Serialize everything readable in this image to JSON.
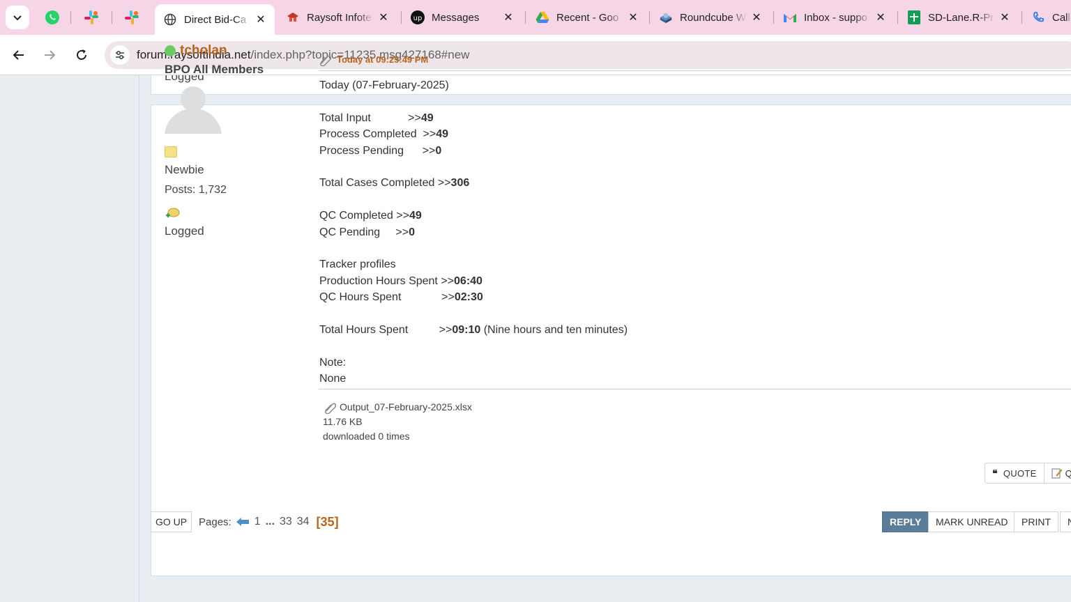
{
  "browser": {
    "tabs": [
      {
        "title": "Direct Bid-Ca",
        "active": true,
        "icon": "globe-icon"
      },
      {
        "title": "Raysoft Infote",
        "icon": "raysoft-icon"
      },
      {
        "title": "Messages",
        "icon": "upwork-icon"
      },
      {
        "title": "Recent - Goo",
        "icon": "google-drive-icon"
      },
      {
        "title": "Roundcube W",
        "icon": "roundcube-icon"
      },
      {
        "title": "Inbox - suppo",
        "icon": "gmail-icon"
      },
      {
        "title": "SD-Lane.R-Pr",
        "icon": "google-sheets-icon"
      },
      {
        "title": "Call",
        "icon": "phone-icon"
      }
    ],
    "url_host": "forum.raysoftindia.net",
    "url_path": "/index.php?topic=11235.msg427168#new"
  },
  "previous_post": {
    "logged": "Logged"
  },
  "poster": {
    "name": "tcholan",
    "group": "BPO All Members",
    "rank": "Newbie",
    "posts": "Posts: 1,732",
    "logged": "Logged"
  },
  "post": {
    "time": "Today at 09:25:49 PM",
    "lines": [
      {
        "label": "Today (07-February-2025)",
        "value": ""
      },
      {
        "gap": true
      },
      {
        "label": "Total Input            >>",
        "value": "49"
      },
      {
        "label": "Process Completed  >>",
        "value": "49"
      },
      {
        "label": "Process Pending      >>",
        "value": "0"
      },
      {
        "gap": true
      },
      {
        "label": "Total Cases Completed >>",
        "value": "306"
      },
      {
        "gap": true
      },
      {
        "label": "QC Completed >>",
        "value": "49"
      },
      {
        "label": "QC Pending     >>",
        "value": "0"
      },
      {
        "gap": true
      },
      {
        "label": "Tracker profiles",
        "value": ""
      },
      {
        "label": "Production Hours Spent >>",
        "value": "06:40"
      },
      {
        "label": "QC Hours Spent             >>",
        "value": "02:30"
      },
      {
        "gap": true
      },
      {
        "label": "Total Hours Spent          >>",
        "value": "09:10",
        "suffix": " (Nine hours and ten minutes)"
      },
      {
        "gap": true
      },
      {
        "label": "Note:",
        "value": ""
      },
      {
        "label": "None",
        "value": ""
      }
    ],
    "attachment": {
      "filename": "Output_07-February-2025.xlsx",
      "size": "11.76 KB",
      "downloads": "downloaded 0 times"
    },
    "buttons": {
      "quote": "QUOTE",
      "quick_edit": "Q"
    }
  },
  "bottom": {
    "go_up": "GO UP",
    "pages_label": "Pages:",
    "page_first": "1",
    "ellipsis": "...",
    "page_a": "33",
    "page_b": "34",
    "page_current": "[35]",
    "reply": "REPLY",
    "mark_unread": "MARK UNREAD",
    "print": "PRINT",
    "more": "N"
  },
  "colors": {
    "accent": "#b9631b",
    "reply_button": "#5a7d99",
    "tab_strip": "#f6d5e6"
  }
}
